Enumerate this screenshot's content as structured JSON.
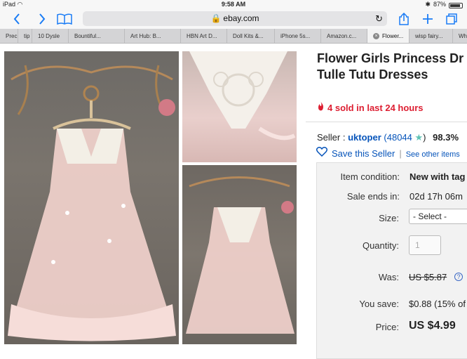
{
  "status": {
    "device": "iPad",
    "time": "9:58 AM",
    "battery_text": "87%",
    "battery_level": 0.87
  },
  "toolbar": {
    "url": "ebay.com"
  },
  "tabs": [
    {
      "label": "Prec",
      "active": false
    },
    {
      "label": "tip",
      "active": false
    },
    {
      "label": "10 Dysle",
      "active": false
    },
    {
      "label": "Bountiful...",
      "active": false
    },
    {
      "label": "Art Hub: B...",
      "active": false
    },
    {
      "label": "HBN Art D...",
      "active": false
    },
    {
      "label": "Doll Kits &...",
      "active": false
    },
    {
      "label": "iPhone 5s...",
      "active": false
    },
    {
      "label": "Amazon.c...",
      "active": false
    },
    {
      "label": "Flower...",
      "active": true
    },
    {
      "label": "wisp fairy...",
      "active": false
    },
    {
      "label": "Where to g",
      "active": false
    }
  ],
  "listing": {
    "title_line1": "Flower Girls Princess Dr",
    "title_line2": "Tulle Tutu Dresses",
    "sold_text": "4 sold in last 24 hours",
    "seller_label": "Seller :",
    "seller_name": "uktoper",
    "feedback_open": "(",
    "feedback_count": "48044",
    "feedback_close": ")",
    "feedback_percent": "98.3%",
    "save_seller": "Save this Seller",
    "see_other": "See other items"
  },
  "details": {
    "condition_label": "Item condition:",
    "condition_value": "New with tag",
    "sale_label": "Sale ends in:",
    "sale_value": "02d 17h 06m",
    "size_label": "Size:",
    "size_value": "- Select -",
    "qty_label": "Quantity:",
    "qty_value": "1",
    "was_label": "Was:",
    "was_value": "US $5.87",
    "save_label": "You save:",
    "save_value": "$0.88 (15% of",
    "price_label": "Price:",
    "price_value": "US $4.99"
  },
  "colors": {
    "accent": "#1a7cf5",
    "link": "#0654ba",
    "urgent": "#dd1e31"
  }
}
